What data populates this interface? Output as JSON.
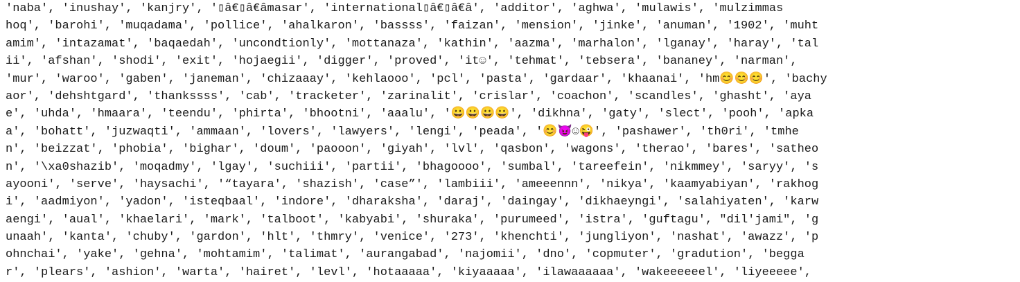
{
  "output": {
    "lines": [
      "'naba', 'inushay', 'kanjry', '▯â€▯â€âmasar', 'international▯â€▯â€â', 'additor', 'aghwa', 'mulawis', 'mulzimmas",
      "hoq', 'barohi', 'muqadama', 'pollice', 'ahalkaron', 'bassss', 'faizan', 'mension', 'jinke', 'anuman', '1902', 'muht",
      "amim', 'intazamat', 'baqaedah', 'uncondtionly', 'mottanaza', 'kathin', 'aazma', 'marhalon', 'lganay', 'haray', 'tal",
      "ii', 'afshan', 'shodi', 'exit', 'hojaegii', 'digger', 'proved', 'it☺', 'tehmat', 'tebsera', 'bananey', 'narman',",
      "'mur', 'waroo', 'gaben', 'janeman', 'chizaaay', 'kehlaooo', 'pcl', 'pasta', 'gardaar', 'khaanai', 'hm😊😊😊', 'bachy",
      "aor', 'dehshtgard', 'thankssss', 'cab', 'tracketer', 'zarinalit', 'crislar', 'coachon', 'scandles', 'ghasht', 'aya",
      "e', 'uhda', 'hmaara', 'teendu', 'phirta', 'bhootni', 'aaalu', '😀😀😀😀', 'dikhna', 'gaty', 'slect', 'pooh', 'apka",
      "a', 'bohatt', 'juzwaqti', 'ammaan', 'lovers', 'lawyers', 'lengi', 'peada', '😊😈☺😜', 'pashawer', 'th0ri', 'tmhe",
      "n', 'beizzat', 'phobia', 'bighar', 'doum', 'paooon', 'giyah', 'lvl', 'qasbon', 'wagons', 'therao', 'bares', 'satheo",
      "n', '\\xa0shazib', 'moqadmy', 'lgay', 'suchiii', 'partii', 'bhagoooo', 'sumbal', 'tareefein', 'nikmmey', 'saryy', 's",
      "ayooni', 'serve', 'haysachi', '“tayara', 'shazish', 'case”', 'lambiii', 'ameeennn', 'nikya', 'kaamyabiyan', 'rakhog",
      "i', 'aadmiyon', 'yadon', 'isteqbaal', 'indore', 'dharaksha', 'daraj', 'daingay', 'dikhaeyngi', 'salahiyaten', 'karw",
      "aengi', 'aual', 'khaelari', 'mark', 'talboot', 'kabyabi', 'shuraka', 'purumeed', 'istra', 'guftagu', \"dil'jami\", 'g",
      "unaah', 'kanta', 'chuby', 'gardon', 'hlt', 'thmry', 'venice', '273', 'khenchti', 'jungliyon', 'nashat', 'awazz', 'p",
      "ohnchai', 'yake', 'gehna', 'mohtamim', 'talimat', 'aurangabad', 'najomii', 'dno', 'copmuter', 'gradution', 'begga",
      "r', 'plears', 'ashion', 'warta', 'hairet', 'levl', 'hotaaaaa', 'kiyaaaaa', 'ilawaaaaaa', 'wakeeeeeel', 'liyeeeee',"
    ]
  }
}
